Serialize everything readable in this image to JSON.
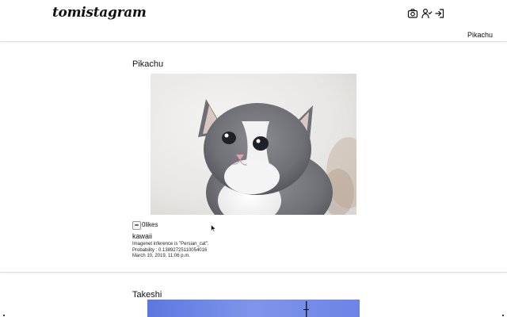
{
  "header": {
    "logo": "tomistagram",
    "icons": [
      "camera-icon",
      "user-check-icon",
      "logout-icon"
    ],
    "username": "Pikachu"
  },
  "posts": [
    {
      "author": "Pikachu",
      "image": "grey and white kitten",
      "likes": "0likes",
      "caption": "kawaii",
      "inference": "Imagenet inference is \"Persian_cat\".",
      "probability": "Probability : 0.13892725110054016",
      "date": "March 10, 2019, 11:06 p.m."
    },
    {
      "author": "Takeshi",
      "image": "blue sky with tower"
    }
  ],
  "colors": {
    "background": "#ffffff",
    "text": "#111111",
    "divider": "#dddddd",
    "sky": "#6f86e6"
  }
}
